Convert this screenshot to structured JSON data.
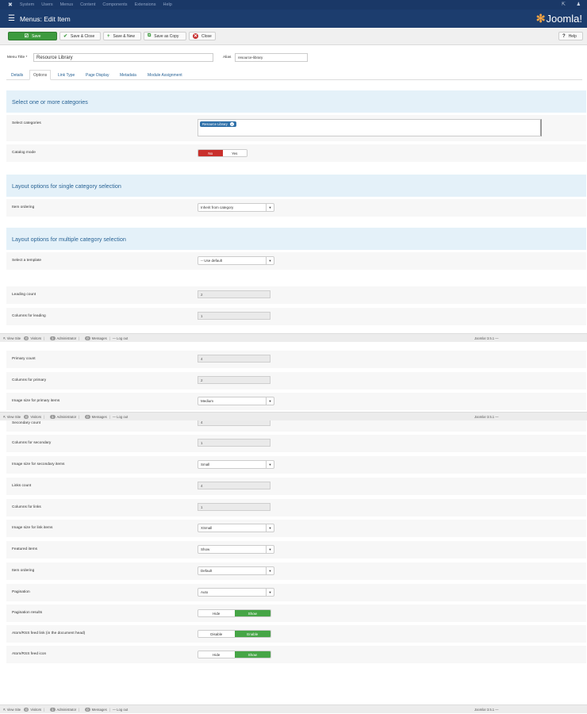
{
  "topnav": {
    "items": [
      "System",
      "Users",
      "Menus",
      "Content",
      "Components",
      "Extensions",
      "Help"
    ]
  },
  "header": {
    "title": "Menus: Edit Item",
    "logo_text": "Joomla!"
  },
  "toolbar": {
    "save": "Save",
    "save_close": "Save & Close",
    "save_new": "Save & New",
    "save_copy": "Save as Copy",
    "close": "Close",
    "help": "Help"
  },
  "form": {
    "menu_title_label": "Menu Title *",
    "menu_title_value": "Resource Library",
    "alias_label": "Alias",
    "alias_value": "resource-library"
  },
  "tabs": [
    "Details",
    "Options",
    "Link Type",
    "Page Display",
    "Metadata",
    "Module Assignment"
  ],
  "sections": {
    "categories": "Select one or more categories",
    "single": "Layout options for single category selection",
    "multiple": "Layout options for multiple category selection"
  },
  "rows": {
    "select_categories": "Select categories",
    "category_tag": "Resource Library",
    "catalog_mode": "Catalog mode",
    "catalog_no": "No",
    "catalog_yes": "Yes",
    "item_ordering_single": "Item ordering",
    "item_ordering_single_value": "Inherit from category",
    "select_template": "Select a template",
    "select_template_value": "-- Use default",
    "leading_count": "Leading count",
    "leading_count_value": "2",
    "columns_leading": "Columns for leading",
    "columns_leading_value": "1",
    "primary_count": "Primary count",
    "primary_count_value": "4",
    "columns_primary": "Columns for primary",
    "columns_primary_value": "2",
    "image_size_primary": "Image size for primary items",
    "image_size_primary_value": "Medium",
    "secondary_count": "Secondary count",
    "secondary_count_value": "4",
    "columns_secondary": "Columns for secondary",
    "columns_secondary_value": "1",
    "image_size_secondary": "Image size for secondary items",
    "image_size_secondary_value": "Small",
    "links_count": "Links count",
    "links_count_value": "4",
    "columns_links": "Columns for links",
    "columns_links_value": "1",
    "image_size_links": "Image size for link items",
    "image_size_links_value": "XSmall",
    "featured_items": "Featured items",
    "featured_items_value": "Show",
    "item_ordering": "Item ordering",
    "item_ordering_value": "Default",
    "pagination": "Pagination",
    "pagination_value": "Auto",
    "pagination_results": "Pagination results",
    "pr_hide": "Hide",
    "pr_show": "Show",
    "feed_link": "Atom/RSS feed link (in the document head)",
    "fl_disable": "Disable",
    "fl_enable": "Enable",
    "feed_icon": "Atom/RSS feed icon",
    "fi_hide": "Hide",
    "fi_show": "Show"
  },
  "status": {
    "view_site": "View Site",
    "visitors_count": "0",
    "visitors": "Visitors",
    "admins_count": "1",
    "administrator": "Administrator",
    "messages_count": "0",
    "messages": "Messages",
    "logout": "Log out",
    "version": "Joomla! 3.5.1 —"
  }
}
